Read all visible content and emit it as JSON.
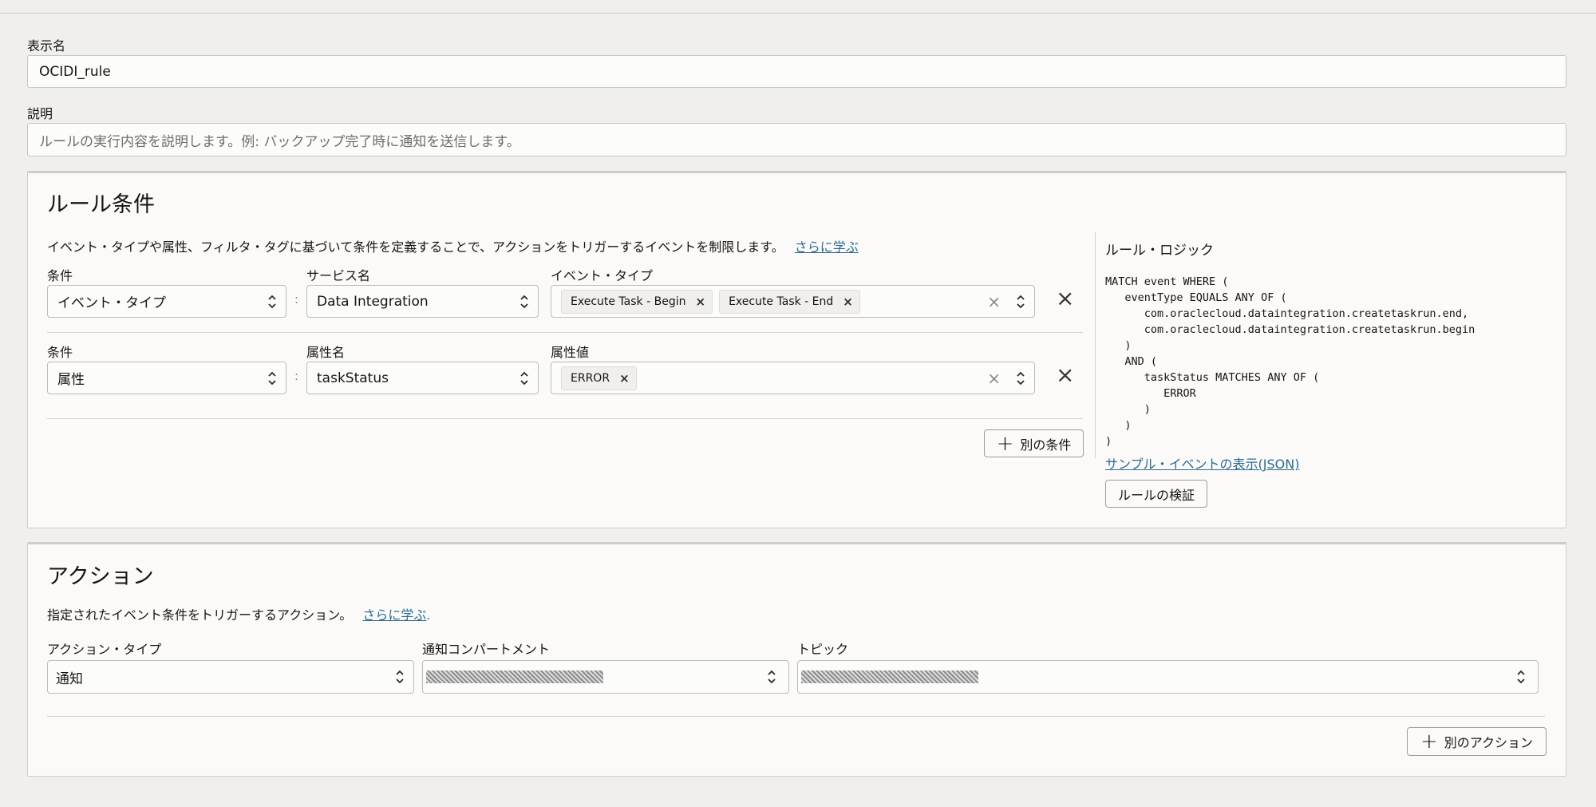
{
  "form": {
    "display_name_label": "表示名",
    "display_name_value": "OCIDI_rule",
    "description_label": "説明",
    "description_placeholder": "ルールの実行内容を説明します。例: バックアップ完了時に通知を送信します。"
  },
  "rule_conditions": {
    "title": "ルール条件",
    "description": "イベント・タイプや属性、フィルタ・タグに基づいて条件を定義することで、アクションをトリガーするイベントを制限します。",
    "learn_more": "さらに学ぶ",
    "rows": [
      {
        "condition_label": "条件",
        "condition_value": "イベント・タイプ",
        "field2_label": "サービス名",
        "field2_value": "Data Integration",
        "field3_label": "イベント・タイプ",
        "chips": [
          "Execute Task - Begin",
          "Execute Task - End"
        ]
      },
      {
        "condition_label": "条件",
        "condition_value": "属性",
        "field2_label": "属性名",
        "field2_value": "taskStatus",
        "field3_label": "属性値",
        "chips": [
          "ERROR"
        ]
      }
    ],
    "add_condition": "別の条件",
    "rule_logic": {
      "title": "ルール・ロジック",
      "code": "MATCH event WHERE (\n   eventType EQUALS ANY OF (\n      com.oraclecloud.dataintegration.createtaskrun.end,\n      com.oraclecloud.dataintegration.createtaskrun.begin\n   )\n   AND (\n      taskStatus MATCHES ANY OF (\n         ERROR\n      )\n   )\n)",
      "sample_link": "サンプル・イベントの表示(JSON)",
      "validate": "ルールの検証"
    }
  },
  "actions": {
    "title": "アクション",
    "description": "指定されたイベント条件をトリガーするアクション。",
    "learn_more": "さらに学ぶ",
    "action_type_label": "アクション・タイプ",
    "action_type_value": "通知",
    "compartment_label": "通知コンパートメント",
    "topic_label": "トピック",
    "add_action": "別のアクション"
  },
  "icons": {
    "chevron": "chevron-up-down-icon",
    "remove": "close-icon",
    "add": "plus-icon"
  },
  "colors": {
    "link": "#2c6b92",
    "background": "#f1efed"
  }
}
